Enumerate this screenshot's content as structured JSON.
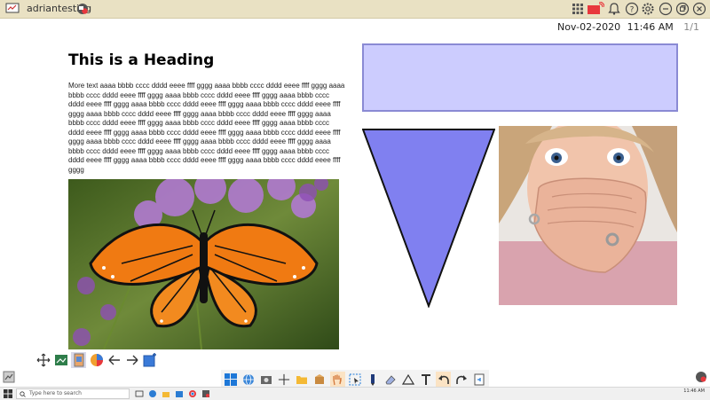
{
  "app": {
    "user": "adriantesting",
    "date": "Nov-02-2020",
    "time": "11:46 AM",
    "page_count": "1/1"
  },
  "content": {
    "heading": "This is a Heading",
    "body": "More text aaaa bbbb cccc dddd eeee ffff gggg aaaa bbbb cccc dddd eeee ffff gggg aaaa bbbb cccc dddd eeee ffff gggg aaaa bbbb cccc dddd eeee ffff gggg aaaa bbbb cccc dddd eeee ffff gggg aaaa bbbb cccc dddd eeee ffff gggg aaaa bbbb cccc dddd eeee ffff gggg aaaa bbbb cccc dddd eeee ffff gggg aaaa bbbb cccc dddd eeee ffff gggg aaaa bbbb cccc dddd eeee ffff gggg aaaa bbbb cccc dddd eeee ffff gggg aaaa bbbb cccc dddd eeee ffff gggg aaaa bbbb cccc dddd eeee ffff gggg aaaa bbbb cccc dddd eeee ffff gggg aaaa bbbb cccc dddd eeee ffff gggg aaaa bbbb cccc dddd eeee ffff gggg aaaa bbbb cccc dddd eeee ffff gggg aaaa bbbb cccc dddd eeee ffff gggg aaaa bbbb cccc dddd eeee ffff gggg aaaa bbbb cccc dddd eeee ffff gggg aaaa bbbb cccc dddd eeee ffff gggg"
  },
  "colors": {
    "titlebar": "#e9e1c3",
    "rect_fill": "#ccccfe",
    "triangle_fill": "#8080f0",
    "accent_red": "#e8383d"
  },
  "taskbar": {
    "search_placeholder": "Type here to search"
  },
  "icons": {
    "titlebar_buttons": [
      "grid-icon",
      "cast-icon",
      "bell-icon",
      "help-icon",
      "gear-icon",
      "minimize-icon",
      "restore-icon",
      "close-icon"
    ],
    "left_toolbar": [
      "move-icon",
      "screenshot-icon",
      "page-icon",
      "color-wheel-icon",
      "arrow-left-icon",
      "arrow-right-icon",
      "add-page-icon"
    ],
    "center_toolbar": [
      "windows-icon",
      "globe-icon",
      "camera-icon",
      "move-icon",
      "folder-icon",
      "box-icon",
      "hand-icon",
      "select-icon",
      "pen-icon",
      "eraser-icon",
      "triangle-icon",
      "text-icon",
      "undo-icon",
      "redo-icon",
      "page-icon"
    ]
  }
}
